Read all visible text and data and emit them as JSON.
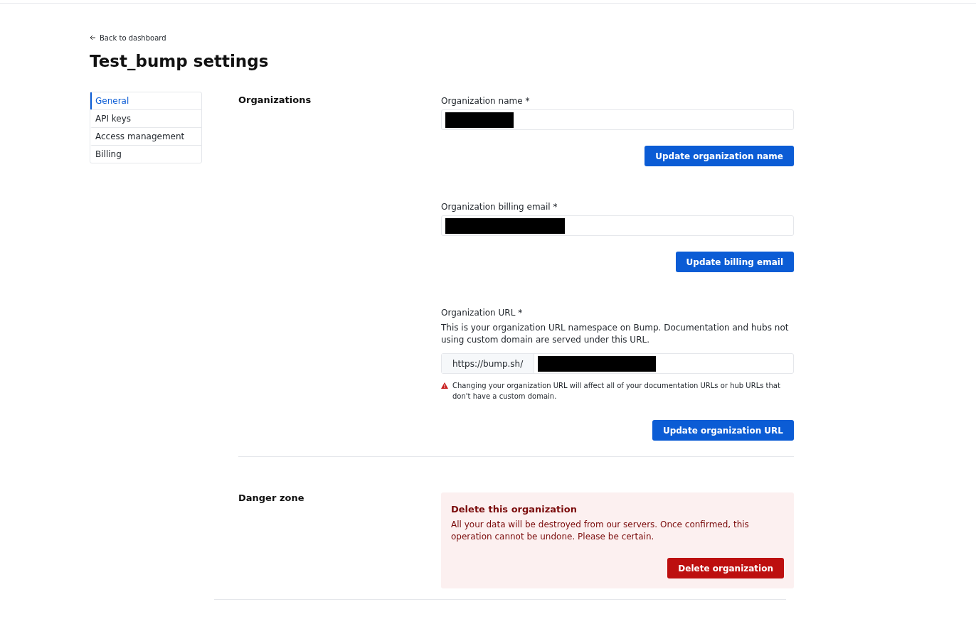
{
  "back_link": "Back to dashboard",
  "title": "Test_bump settings",
  "sidebar": {
    "items": [
      {
        "label": "General",
        "selected": true
      },
      {
        "label": "API keys",
        "selected": false
      },
      {
        "label": "Access management",
        "selected": false
      },
      {
        "label": "Billing",
        "selected": false
      }
    ]
  },
  "organizations": {
    "heading": "Organizations",
    "fields": [
      {
        "label": "Organization name *",
        "redacted": true,
        "button": "Update organization name"
      },
      {
        "label": "Organization billing email *",
        "redacted": true,
        "button": "Update billing email"
      },
      {
        "label": "Organization URL *",
        "description": "This is your organization URL namespace on Bump. Documentation and hubs not using custom domain are served under this URL.",
        "prefix": "https://bump.sh/",
        "redacted": true,
        "warning": "Changing your organization URL will affect all of your documentation URLs or hub URLs that don't have a custom domain.",
        "button": "Update organization URL"
      }
    ]
  },
  "danger_zone": {
    "heading": "Danger zone",
    "title": "Delete this organization",
    "text": "All your data will be destroyed from our servers. Once confirmed, this operation cannot be undone. Please be certain.",
    "button": "Delete organization"
  }
}
